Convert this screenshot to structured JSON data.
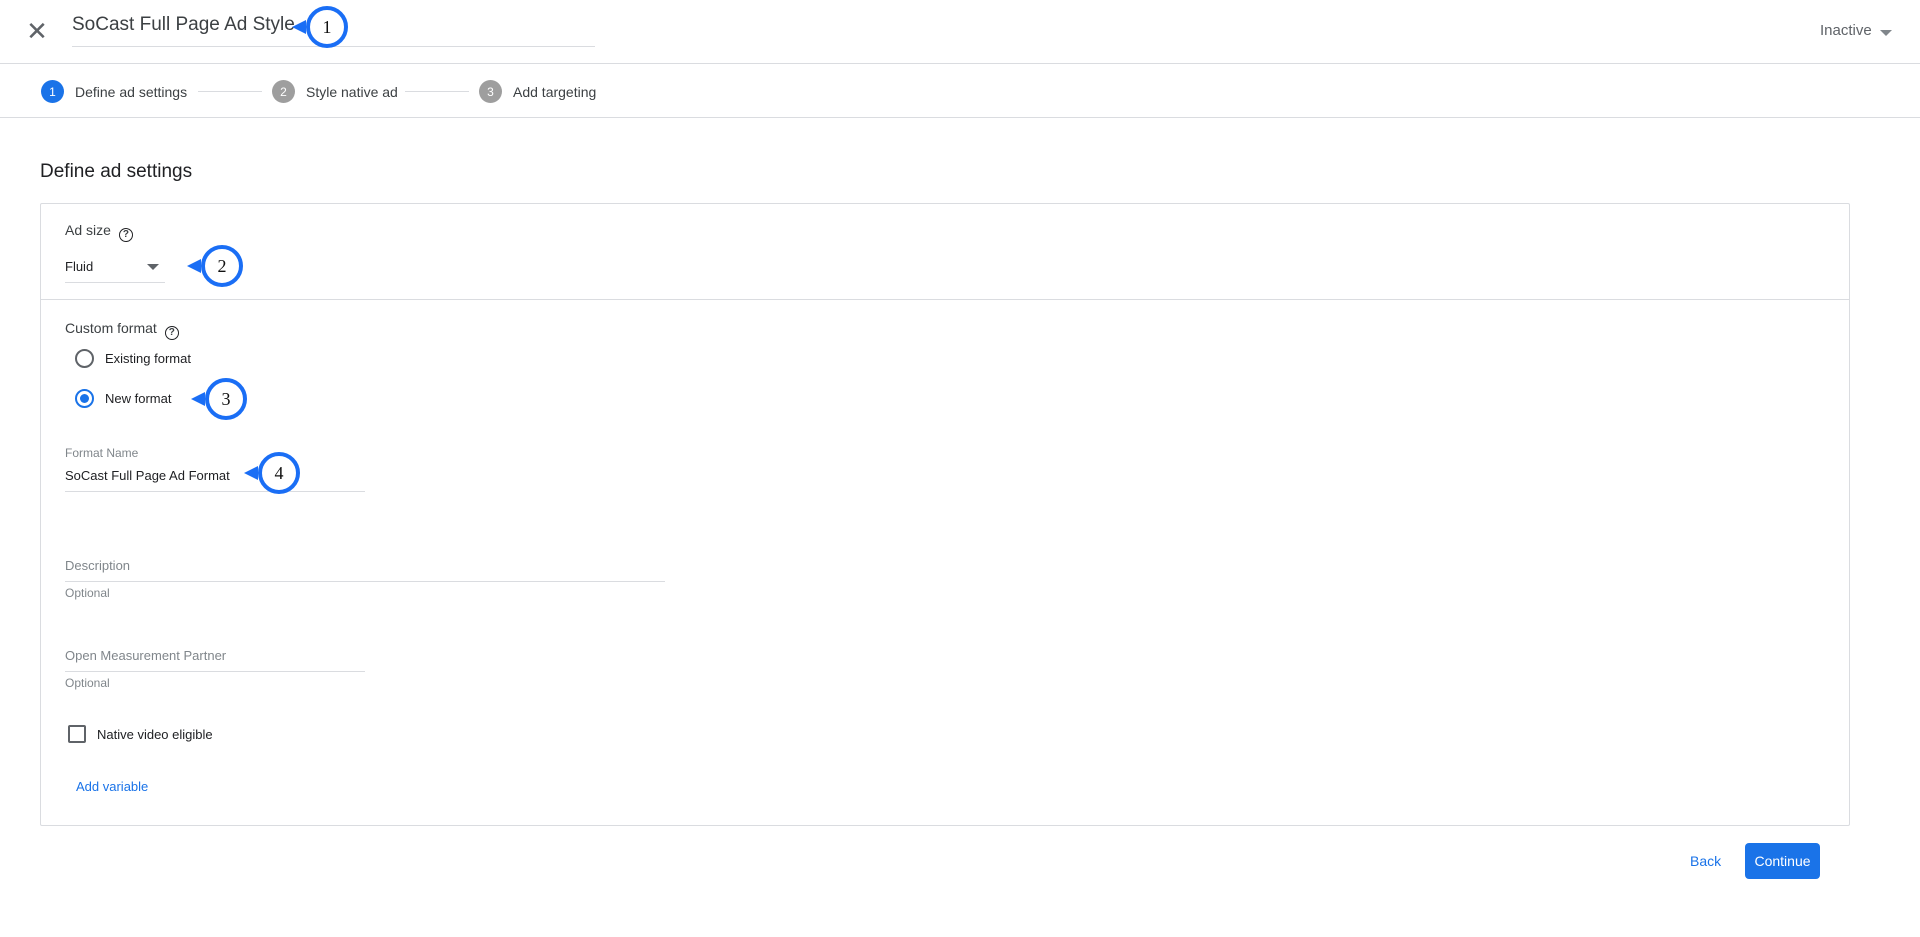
{
  "header": {
    "title": "SoCast Full Page Ad Style",
    "status": "Inactive",
    "close_icon": "close-icon"
  },
  "stepper": {
    "steps": [
      {
        "num": "1",
        "label": "Define ad settings"
      },
      {
        "num": "2",
        "label": "Style native ad"
      },
      {
        "num": "3",
        "label": "Add targeting"
      }
    ]
  },
  "page": {
    "heading": "Define ad settings"
  },
  "ad_size": {
    "label": "Ad size",
    "help": "?",
    "value": "Fluid"
  },
  "custom_format": {
    "label": "Custom format",
    "help": "?",
    "options": [
      "Existing format",
      "New format"
    ],
    "selected": "New format"
  },
  "format_name": {
    "label": "Format Name",
    "value": "SoCast Full Page Ad Format"
  },
  "description": {
    "placeholder": "Description",
    "hint": "Optional"
  },
  "om_partner": {
    "placeholder": "Open Measurement Partner",
    "hint": "Optional"
  },
  "native_video": {
    "label": "Native video eligible",
    "checked": false
  },
  "add_variable": "Add variable",
  "footer": {
    "back": "Back",
    "continue": "Continue"
  },
  "annotations": [
    "1",
    "2",
    "3",
    "4"
  ],
  "colors": {
    "accent": "#1a73e8",
    "annotation": "#1a6ef5"
  }
}
